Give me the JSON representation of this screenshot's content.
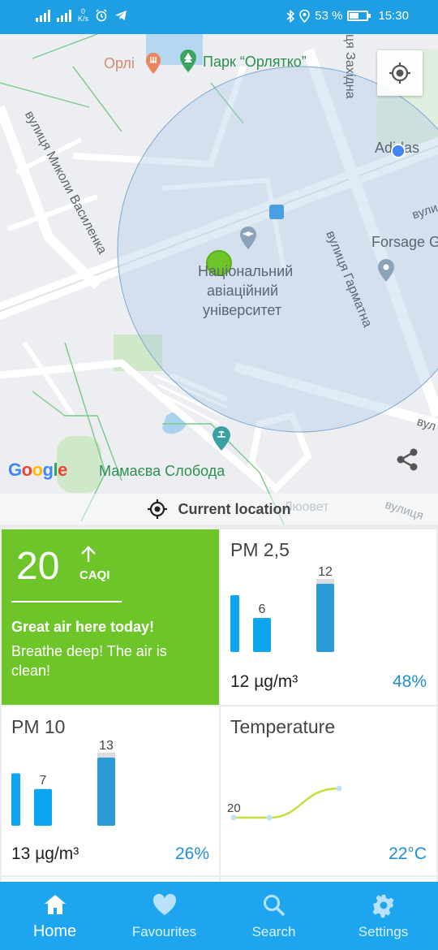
{
  "status": {
    "net_speed_value": "0",
    "net_speed_unit": "K/s",
    "battery": "53 %",
    "battery_level": 0.53,
    "time": "15:30"
  },
  "map": {
    "labels": {
      "orl": "Орлі",
      "park": "Парк “Орлятко”",
      "zakhidna": "ця Західна",
      "adidas": "Adidas",
      "vasylenka": "вулиця Миколи Василенка",
      "vul_right": "вули",
      "forsage": "Forsage Golf",
      "uni_line1": "Національний",
      "uni_line2": "авіаційний",
      "uni_line3": "університет",
      "harmatna": "вулиця Гарматна",
      "vul_right2": "вул",
      "mamaeva": "Мамаєва Слобода",
      "lyuvet": "Люовет",
      "vulytsia_br": "вулиця"
    },
    "google": "Google",
    "current_location": "Current location",
    "icons": {
      "locate": "my-location-icon",
      "share": "share-icon"
    }
  },
  "caqi": {
    "value": "20",
    "label": "CAQI",
    "trend": "up-arrow-icon",
    "message_title": "Great air here today!",
    "message_body": "Breathe deep! The air is clean!",
    "color": "#6ec52a"
  },
  "pm25": {
    "title": "PM 2,5",
    "value": "12 µg/m³",
    "percent": "48%",
    "bars": [
      {
        "label": "",
        "value": 10
      },
      {
        "label": "6",
        "value": 6
      },
      {
        "label": "12",
        "value": 12
      }
    ]
  },
  "pm10": {
    "title": "PM 10",
    "value": "13 µg/m³",
    "percent": "26%",
    "bars": [
      {
        "label": "",
        "value": 10
      },
      {
        "label": "7",
        "value": 7
      },
      {
        "label": "13",
        "value": 13
      }
    ]
  },
  "temperature": {
    "title": "Temperature",
    "value": "22°C",
    "start_label": "20",
    "points": [
      20,
      20,
      22
    ]
  },
  "nav": {
    "home": "Home",
    "favourites": "Favourites",
    "search": "Search",
    "settings": "Settings"
  },
  "colors": {
    "accent": "#1da6ef",
    "statusbar": "#1e9ee3",
    "good": "#6ec52a",
    "bar_light": "#0ea5f0",
    "bar_dark": "#2b9ad6",
    "percent": "#1e8fd5"
  }
}
